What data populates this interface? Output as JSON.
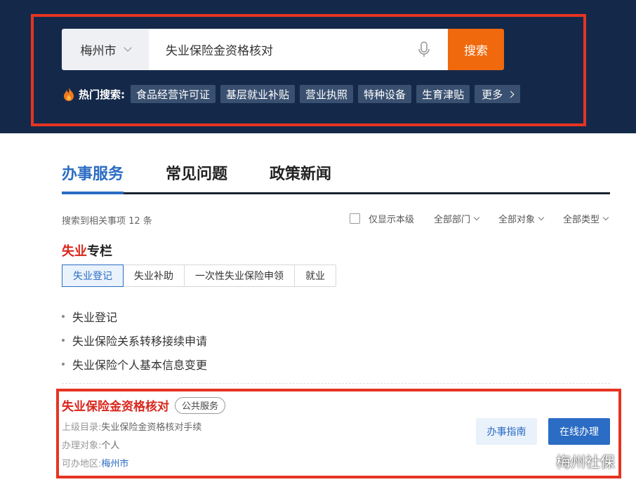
{
  "colors": {
    "header_bg": "#14294a",
    "accent_orange": "#f0690c",
    "primary_blue": "#2b6cc4",
    "highlight_red": "#d9261c",
    "annotation_red": "#e63422"
  },
  "search": {
    "city": "梅州市",
    "query": "失业保险金资格核对",
    "button_label": "搜索",
    "mic_icon": "microphone-icon"
  },
  "hot_search": {
    "icon": "flame-icon",
    "label": "热门搜索:",
    "tags": [
      "食品经营许可证",
      "基层就业补贴",
      "营业执照",
      "特种设备",
      "生育津贴"
    ],
    "more_label": "更多"
  },
  "tabs": [
    {
      "label": "办事服务",
      "active": true
    },
    {
      "label": "常见问题",
      "active": false
    },
    {
      "label": "政策新闻",
      "active": false
    }
  ],
  "results": {
    "count_text": "搜索到相关事项 12 条"
  },
  "filters": {
    "only_local_label": "仅显示本级",
    "only_local_checked": false,
    "dropdowns": [
      "全部部门",
      "全部对象",
      "全部类型"
    ]
  },
  "column": {
    "title_highlight": "失业",
    "title_rest": "专栏",
    "sub_tabs": [
      {
        "label": "失业登记",
        "active": true
      },
      {
        "label": "失业补助",
        "active": false
      },
      {
        "label": "一次性失业保险申领",
        "active": false
      },
      {
        "label": "就业",
        "active": false
      }
    ],
    "items": [
      "失业登记",
      "失业保险关系转移接续申请",
      "失业保险个人基本信息变更"
    ]
  },
  "card": {
    "title": "失业保险金资格核对",
    "badge": "公共服务",
    "parent_label": "上级目录:",
    "parent_value": "失业保险金资格核对手续",
    "target_label": "办理对象:",
    "target_value": "个人",
    "region_label": "可办地区:",
    "region_value": "梅州市",
    "guide_button": "办事指南",
    "online_button": "在线办理"
  },
  "watermark": {
    "icon": "wechat-icon",
    "text": "梅州社保"
  }
}
